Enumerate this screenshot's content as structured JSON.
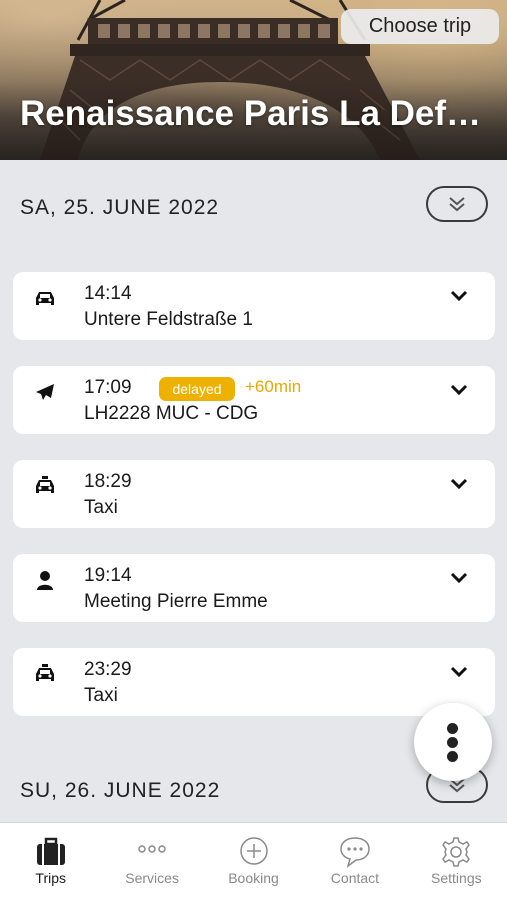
{
  "header": {
    "choose_trip_label": "Choose trip",
    "title": "Renaissance Paris La Def…"
  },
  "days": [
    {
      "date_label": "SA, 25. JUNE 2022",
      "events": [
        {
          "icon": "car-icon",
          "time": "14:14",
          "description": "Untere Feldstraße 1"
        },
        {
          "icon": "airplane-icon",
          "time": "17:09",
          "status_badge": "delayed",
          "delay_text": "+60min",
          "description": "LH2228 MUC - CDG"
        },
        {
          "icon": "taxi-icon",
          "time": "18:29",
          "description": "Taxi"
        },
        {
          "icon": "person-icon",
          "time": "19:14",
          "description": "Meeting Pierre Emme"
        },
        {
          "icon": "taxi-icon",
          "time": "23:29",
          "description": "Taxi"
        }
      ]
    },
    {
      "date_label": "SU, 26. JUNE 2022",
      "events": []
    }
  ],
  "bottom_nav": {
    "items": [
      {
        "label": "Trips",
        "icon": "suitcase-icon",
        "active": true
      },
      {
        "label": "Services",
        "icon": "dots-icon",
        "active": false
      },
      {
        "label": "Booking",
        "icon": "plus-circle-icon",
        "active": false
      },
      {
        "label": "Contact",
        "icon": "chat-bubble-icon",
        "active": false
      },
      {
        "label": "Settings",
        "icon": "gear-icon",
        "active": false
      }
    ]
  },
  "colors": {
    "background": "#e6e7eb",
    "card": "#ffffff",
    "delay_accent": "#efb100",
    "text": "#1a1a1a",
    "nav_inactive": "#8a8a8a"
  }
}
